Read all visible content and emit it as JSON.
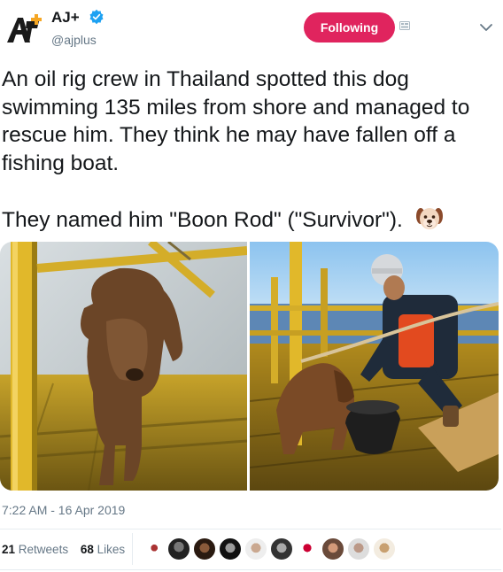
{
  "account": {
    "name": "AJ+",
    "handle": "@ajplus",
    "follow_label": "Following"
  },
  "tweet": {
    "text": "An oil rig crew in Thailand spotted this dog swimming 135 miles from shore and managed to rescue him. They think he may have fallen off a fishing boat.\n\nThey named him \"Boon Rod\" (\"Survivor\"). ",
    "timestamp": "7:22 AM - 16 Apr 2019"
  },
  "stats": {
    "retweets_count": "21",
    "retweets_label": "Retweets",
    "likes_count": "68",
    "likes_label": "Likes"
  },
  "liker_avatars": [
    "avatar-1",
    "avatar-2",
    "avatar-3",
    "avatar-4",
    "avatar-5",
    "avatar-6",
    "avatar-7",
    "avatar-8",
    "avatar-9",
    "avatar-10"
  ],
  "colors": {
    "follow_button": "#e0245e",
    "verified": "#1da1f2",
    "muted_text": "#657786"
  }
}
